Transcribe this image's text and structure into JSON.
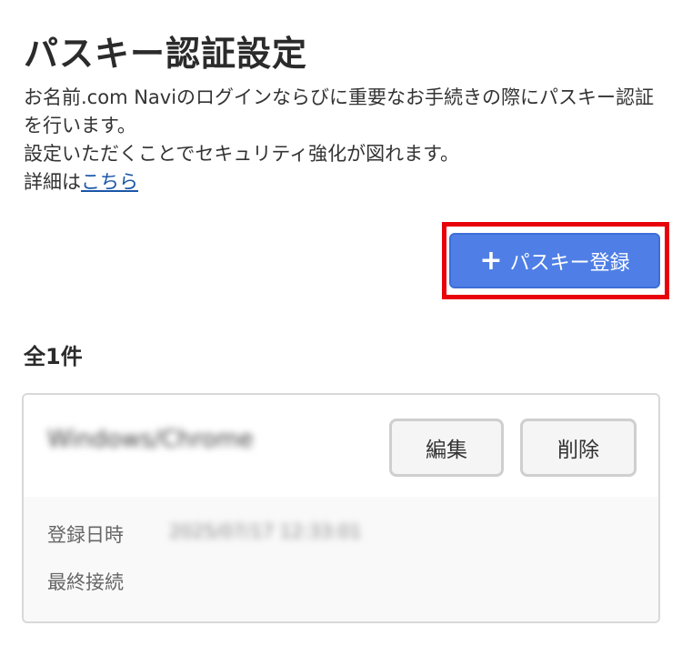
{
  "page": {
    "title": "パスキー認証設定"
  },
  "description": {
    "line1": "お名前.com Naviのログインならびに重要なお手続きの際にパスキー認証を行います。",
    "line2": "設定いただくことでセキュリティ強化が図れます。",
    "details_prefix": "詳細は",
    "details_link": "こちら"
  },
  "actions": {
    "add_icon": "plus-icon",
    "add_glyph": "+",
    "add_label": "パスキー登録"
  },
  "list": {
    "count_label": "全1件",
    "items": [
      {
        "device_name": "Windows/Chrome",
        "edit_label": "編集",
        "delete_label": "削除",
        "registered_label": "登録日時",
        "registered_value": "2025/07/17 12:33:01",
        "last_connected_label": "最終接続"
      }
    ]
  },
  "colors": {
    "primary_button": "#4f7fe6",
    "highlight": "#e8000b",
    "link": "#1a56a8"
  }
}
